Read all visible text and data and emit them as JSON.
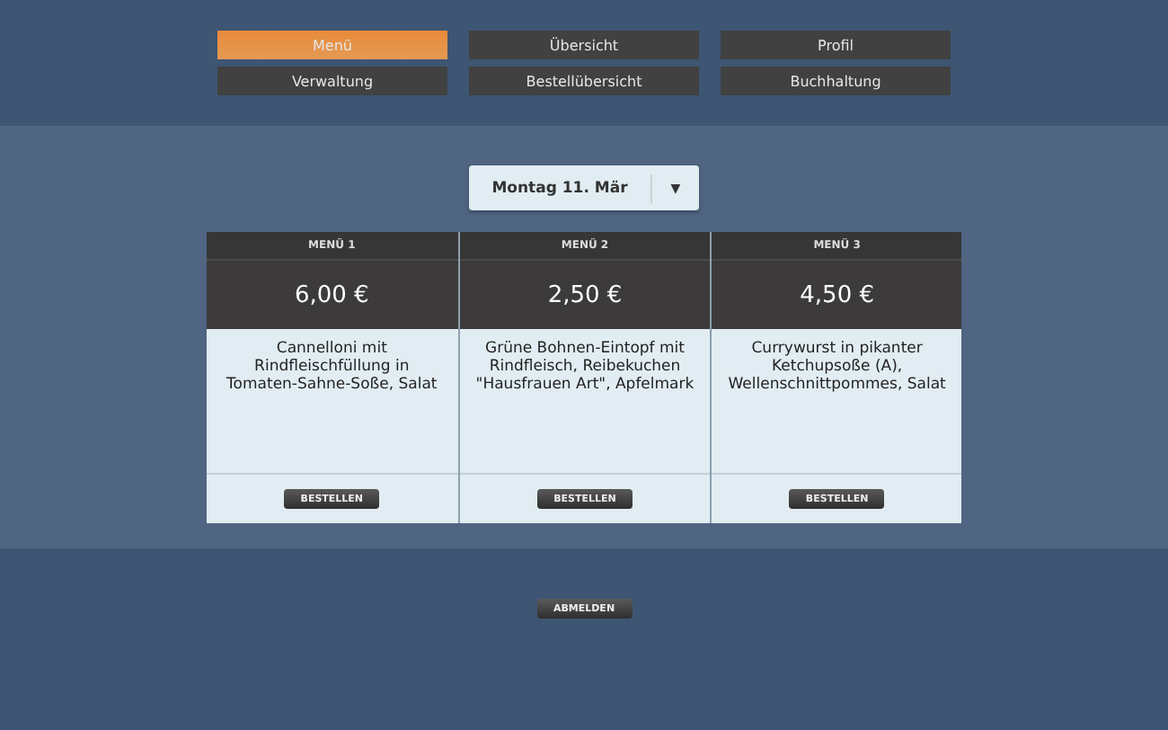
{
  "nav": [
    {
      "label": "Menü",
      "selected": true
    },
    {
      "label": "Übersicht",
      "selected": false
    },
    {
      "label": "Profil",
      "selected": false
    },
    {
      "label": "Verwaltung",
      "selected": false
    },
    {
      "label": "Bestellübersicht",
      "selected": false
    },
    {
      "label": "Buchhaltung",
      "selected": false
    }
  ],
  "date_select": {
    "value": "Montag 11. Mär",
    "arrow": "▼"
  },
  "menus": [
    {
      "title": "MENÜ 1",
      "price": "6,00 €",
      "description": "Cannelloni mit Rindfleischfüllung in Tomaten-Sahne-Soße, Salat",
      "button": "BESTELLEN"
    },
    {
      "title": "MENÜ 2",
      "price": "2,50 €",
      "description": "Grüne Bohnen-Eintopf mit Rindfleisch, Reibekuchen \"Hausfrauen Art\", Apfelmark",
      "button": "BESTELLEN"
    },
    {
      "title": "MENÜ 3",
      "price": "4,50 €",
      "description": "Currywurst in pikanter Ketchupsoße (A), Wellenschnittpommes, Salat",
      "button": "BESTELLEN"
    }
  ],
  "logout": "ABMELDEN"
}
